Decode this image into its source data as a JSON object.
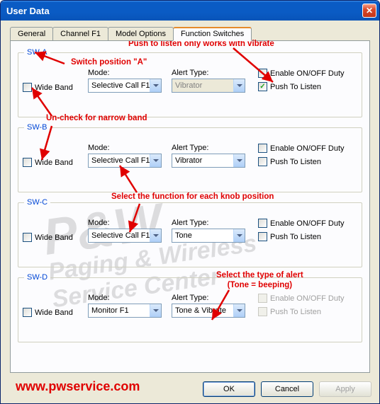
{
  "window": {
    "title": "User Data"
  },
  "tabs": [
    "General",
    "Channel F1",
    "Model Options",
    "Function Switches"
  ],
  "active_tab": 3,
  "labels": {
    "mode": "Mode:",
    "alert": "Alert Type:",
    "wide_band": "Wide Band",
    "enable_duty": "Enable ON/OFF Duty",
    "push_listen": "Push To Listen"
  },
  "switches": [
    {
      "id": "SW-A",
      "wide_band": false,
      "mode": "Selective Call F1",
      "alert": "Vibrator",
      "alert_enabled": false,
      "enable_duty": false,
      "push_listen": true,
      "opts_enabled": true
    },
    {
      "id": "SW-B",
      "wide_band": false,
      "mode": "Selective Call F1",
      "alert": "Vibrator",
      "alert_enabled": true,
      "enable_duty": false,
      "push_listen": false,
      "opts_enabled": true
    },
    {
      "id": "SW-C",
      "wide_band": false,
      "mode": "Selective Call F1",
      "alert": "Tone",
      "alert_enabled": true,
      "enable_duty": false,
      "push_listen": false,
      "opts_enabled": true
    },
    {
      "id": "SW-D",
      "wide_band": false,
      "mode": "Monitor F1",
      "alert": "Tone & Vibrate",
      "alert_enabled": true,
      "enable_duty": false,
      "push_listen": false,
      "opts_enabled": false
    }
  ],
  "buttons": {
    "ok": "OK",
    "cancel": "Cancel",
    "apply": "Apply"
  },
  "annotations": {
    "a1": "Push to listen only works with vibrate",
    "a2": "Switch position \"A\"",
    "a3": "Un-check for narrow band",
    "a4": "Select the function for each knob position",
    "a5": "Select the type of alert\n(Tone = beeping)"
  },
  "url": "www.pwservice.com",
  "watermark": {
    "line1": "P&W",
    "line2": "Paging & Wireless",
    "line3": "Service Center"
  }
}
